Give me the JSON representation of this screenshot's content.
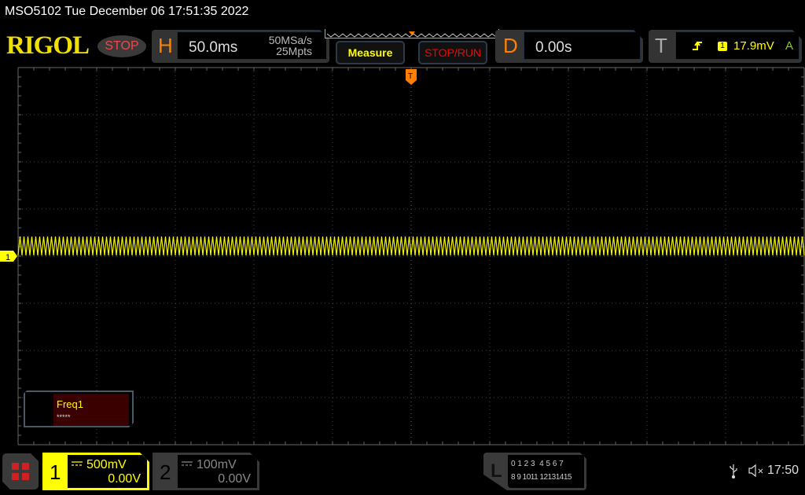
{
  "status_bar": {
    "title": "MSO5102  Tue December 06 17:51:35 2022"
  },
  "header": {
    "logo": "RIGOL",
    "run_state": "STOP",
    "horizontal": {
      "label": "H",
      "timebase": "50.0ms",
      "sample_rate": "50MSa/s",
      "memory_depth": "25Mpts"
    },
    "measure_label": "Measure",
    "stop_run_label": "STOP/RUN",
    "delay": {
      "label": "D",
      "value": "0.00s"
    },
    "trigger": {
      "label": "T",
      "slope_icon": "rising-edge-icon",
      "source": "1",
      "level": "17.9mV",
      "mode": "A"
    }
  },
  "waveform": {
    "channel_marker": "1",
    "trigger_marker": "T",
    "color": "#f5f500"
  },
  "measurement": {
    "name": "Freq1",
    "value": "*****"
  },
  "footer": {
    "channel1": {
      "number": "1",
      "scale": "500mV",
      "offset": "0.00V",
      "coupling_icon": "dc-coupling-icon"
    },
    "channel2": {
      "number": "2",
      "scale": "100mV",
      "offset": "0.00V",
      "coupling_icon": "dc-coupling-icon"
    },
    "logic": {
      "label": "L",
      "row1": "0 1 2 3  4 5 6 7",
      "row2": "8 9 1011 12131415"
    },
    "clock": "17:50"
  }
}
